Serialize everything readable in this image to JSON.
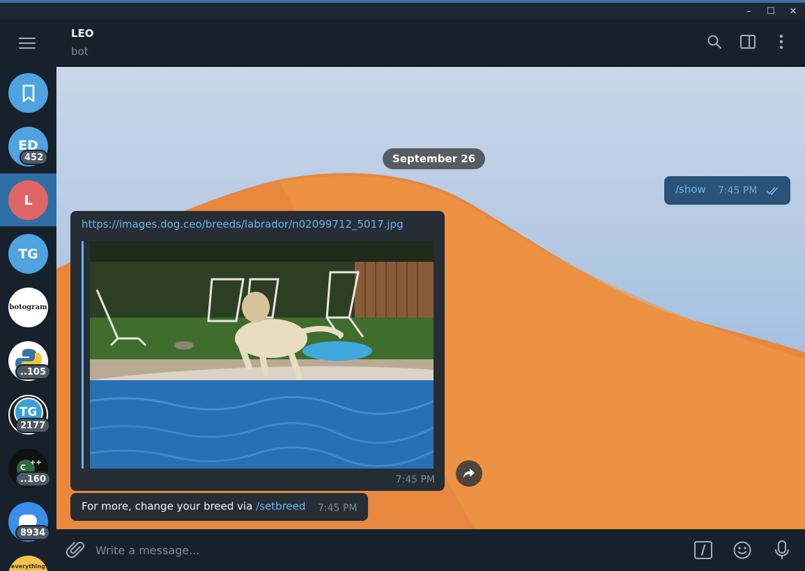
{
  "window": {
    "minimize": "–",
    "maximize": "☐",
    "close": "✕"
  },
  "header": {
    "title": "LEO",
    "subtitle": "bot"
  },
  "rail": {
    "chats": [
      {
        "name": "saved-messages",
        "initials": "",
        "color": "#4ea3e0"
      },
      {
        "name": "ed",
        "initials": "ED",
        "color": "#4ea3e0",
        "badge": "452"
      },
      {
        "name": "leo",
        "initials": "L",
        "color": "#e06666"
      },
      {
        "name": "tg",
        "initials": "TG",
        "color": "#4ea3e0"
      },
      {
        "name": "botogram",
        "initials": "botogram",
        "color": "#ffffff"
      },
      {
        "name": "python",
        "initials": "",
        "color": "#ffffff",
        "badge": "..105"
      },
      {
        "name": "tg-group",
        "initials": "TG",
        "color": "#1f1f1f",
        "badge": "2177"
      },
      {
        "name": "cpp",
        "initials": "",
        "color": "#111111",
        "badge": "..160"
      },
      {
        "name": "chat-blue",
        "initials": "",
        "color": "#3a8eea",
        "badge": "8934"
      },
      {
        "name": "everything",
        "initials": "everything",
        "color": "#f5c24b"
      }
    ]
  },
  "chat": {
    "date": "September 26",
    "outgoing": {
      "text": "/show",
      "time": "7:45 PM"
    },
    "media": {
      "link": "https://images.dog.ceo/breeds/labrador/n02099712_5017.jpg",
      "time": "7:45 PM"
    },
    "incoming": {
      "text": "For more, change your breed via ",
      "command": "/setbreed",
      "time": "7:45 PM"
    }
  },
  "composer": {
    "placeholder": "Write a message..."
  },
  "colors": {
    "accent": "#6ab3f3",
    "active_row": "#2f6ea5",
    "dune": "#e8883e"
  }
}
